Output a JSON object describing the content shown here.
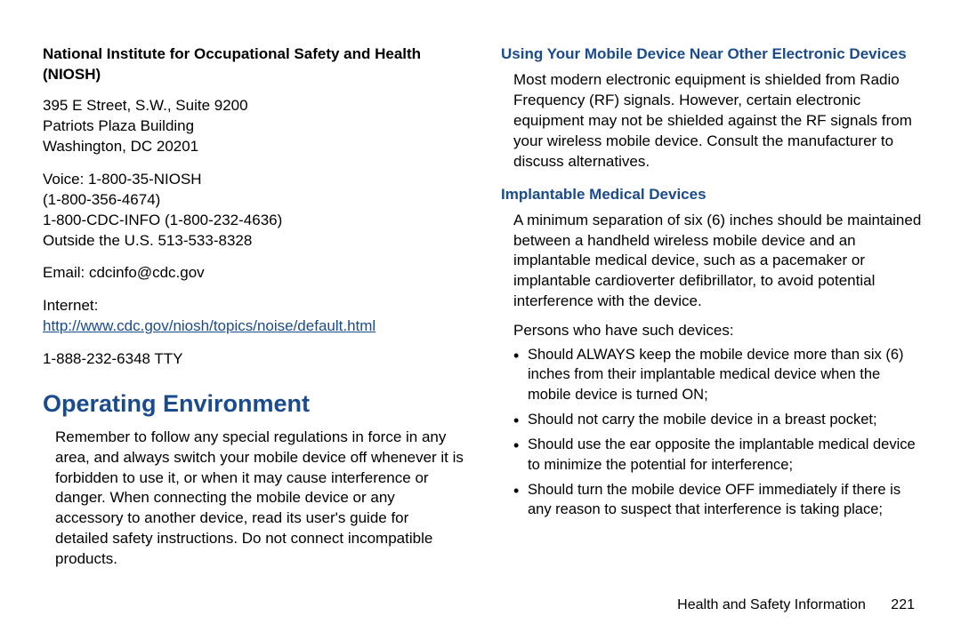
{
  "left": {
    "org_name": "National Institute for Occupational Safety and Health (NIOSH)",
    "addr1": "395 E Street, S.W., Suite 9200",
    "addr2": "Patriots Plaza Building",
    "addr3": "Washington, DC 20201",
    "voice1": "Voice: 1-800-35-NIOSH",
    "voice2": "(1-800-356-4674)",
    "voice3": "1-800-CDC-INFO (1-800-232-4636)",
    "voice4": "Outside the U.S. 513-533-8328",
    "email": "Email: cdcinfo@cdc.gov",
    "internet_label": "Internet:",
    "internet_url": "http://www.cdc.gov/niosh/topics/noise/default.html",
    "tty": "1-888-232-6348 TTY",
    "section_title": "Operating Environment",
    "section_body": "Remember to follow any special regulations in force in any area, and always switch your mobile device off whenever it is forbidden to use it, or when it may cause interference or danger. When connecting the mobile device or any accessory to another device, read its user's guide for detailed safety instructions. Do not connect incompatible products."
  },
  "right": {
    "sub1_title": "Using Your Mobile Device Near Other Electronic Devices",
    "sub1_body": "Most modern electronic equipment is shielded from Radio Frequency (RF) signals. However, certain electronic equipment may not be shielded against the RF signals from your wireless mobile device. Consult the manufacturer to discuss alternatives.",
    "sub2_title": "Implantable Medical Devices",
    "sub2_body": "A minimum separation of six (6) inches should be maintained between a handheld wireless mobile device and an implantable medical device, such as a pacemaker or implantable cardioverter defibrillator, to avoid potential interference with the device.",
    "sub2_lead": "Persons who have such devices:",
    "bullets": [
      "Should ALWAYS keep the mobile device more than six (6) inches from their implantable medical device when the mobile device is turned ON;",
      "Should not carry the mobile device in a breast pocket;",
      "Should use the ear opposite the implantable medical device to minimize the potential for interference;",
      "Should turn the mobile device OFF immediately if there is any reason to suspect that interference is taking place;"
    ]
  },
  "footer": {
    "label": "Health and Safety Information",
    "page": "221"
  }
}
